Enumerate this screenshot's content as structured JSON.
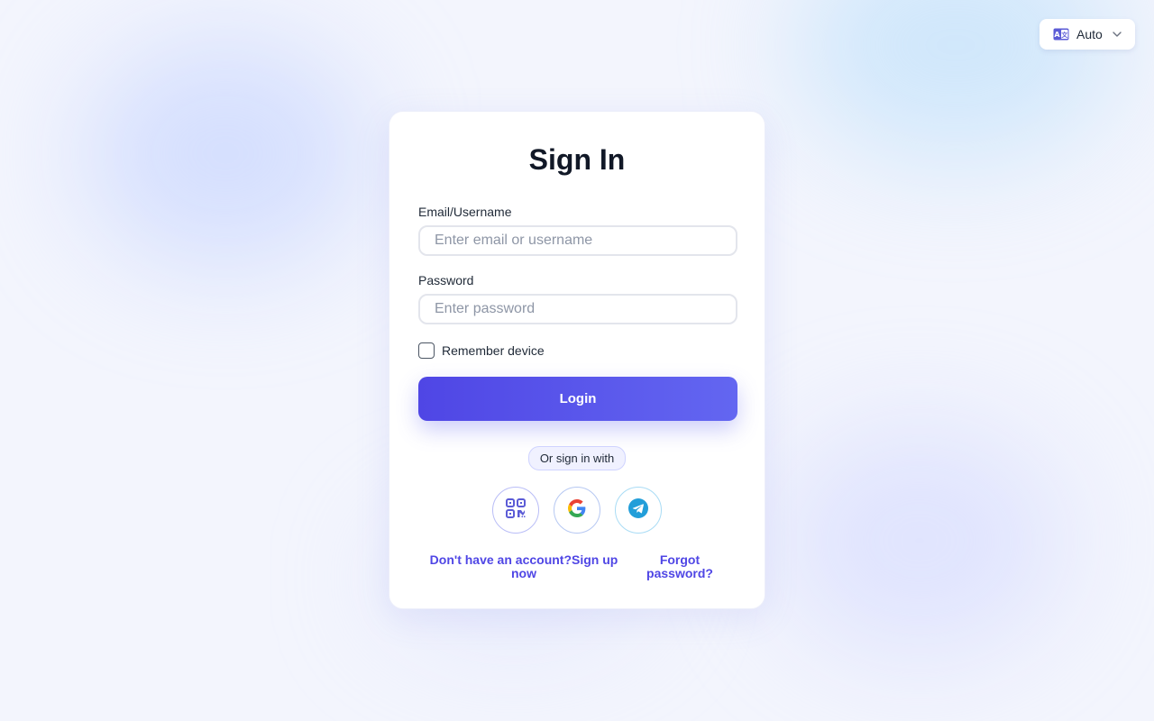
{
  "language": {
    "selected": "Auto",
    "icon": "translate-icon",
    "chevron_icon": "chevron-down-icon"
  },
  "signin": {
    "title": "Sign In",
    "email_label": "Email/Username",
    "email_placeholder": "Enter email or username",
    "password_label": "Password",
    "password_placeholder": "Enter password",
    "remember_label": "Remember device",
    "remember_checked": false,
    "login_label": "Login",
    "divider_text": "Or sign in with",
    "social": [
      {
        "name": "qr-code-icon"
      },
      {
        "name": "google-icon"
      },
      {
        "name": "telegram-icon"
      }
    ],
    "signup_link": "Don't have an account?Sign up now",
    "forgot_link": "Forgot password?"
  },
  "colors": {
    "primary": "#4f46e5",
    "primary_light": "#6366f1",
    "telegram": "#229ed9"
  }
}
